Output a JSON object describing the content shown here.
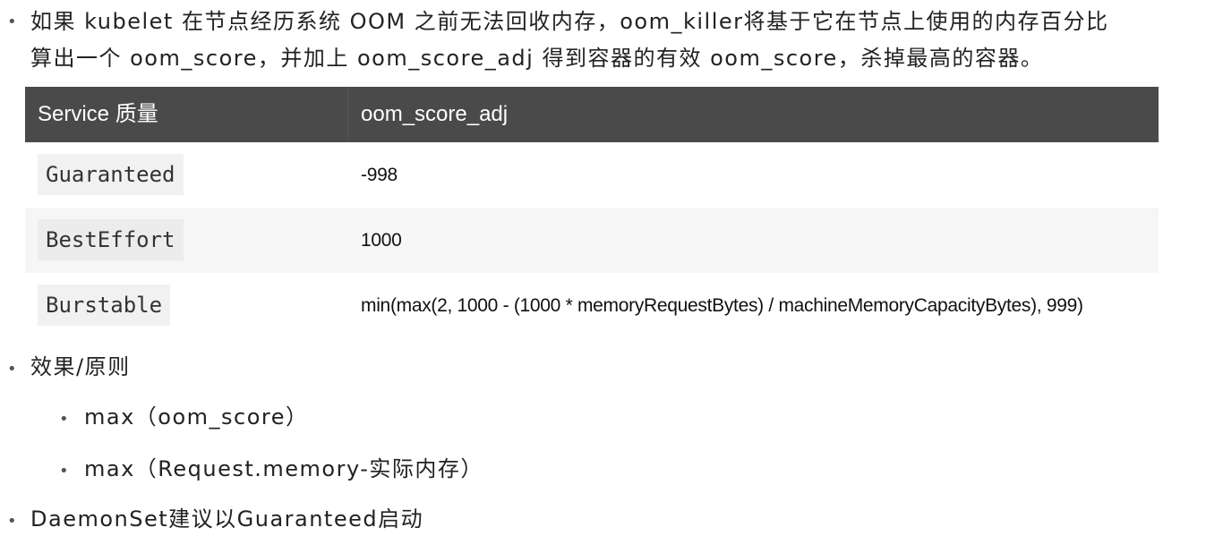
{
  "bullets": {
    "intro_line1": "如果 kubelet 在节点经历系统 OOM 之前无法回收内存，oom_killer将基于它在节点上使用的内存百分比",
    "intro_line2": "算出一个 oom_score，并加上 oom_score_adj 得到容器的有效 oom_score，杀掉最高的容器。",
    "effect": "效果/原则",
    "sub1": "max（oom_score）",
    "sub2": "max（Request.memory-实际内存）",
    "daemonset": "DaemonSet建议以Guaranteed启动"
  },
  "bullet_glyph": "•",
  "table": {
    "headers": [
      "Service 质量",
      "oom_score_adj"
    ],
    "rows": [
      {
        "qos": "Guaranteed",
        "value": "-998"
      },
      {
        "qos": "BestEffort",
        "value": "1000"
      },
      {
        "qos": "Burstable",
        "value": "min(max(2, 1000 - (1000 * memoryRequestBytes) / machineMemoryCapacityBytes), 999)"
      }
    ]
  },
  "colors": {
    "header_bg": "#4a4a4a",
    "stripe_bg": "#f6f6f6",
    "text": "#222222"
  }
}
